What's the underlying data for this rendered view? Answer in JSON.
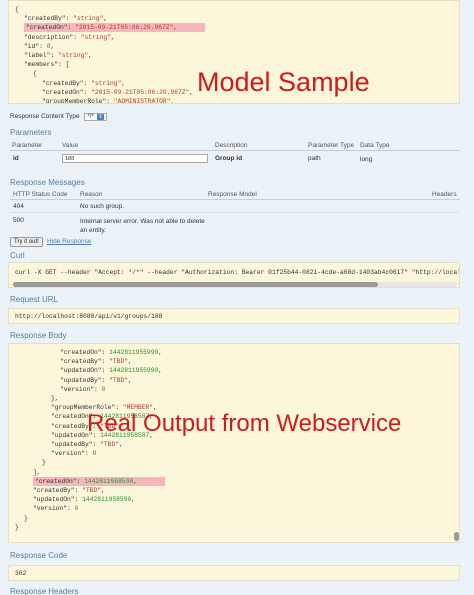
{
  "model_sample": {
    "lines": [
      {
        "indent": 0,
        "parts": [
          {
            "t": "{",
            "c": "k"
          }
        ]
      },
      {
        "indent": 1,
        "parts": [
          {
            "t": "\"createdBy\": ",
            "c": "k"
          },
          {
            "t": "\"string\"",
            "c": "s"
          },
          {
            "t": ",",
            "c": "k"
          }
        ]
      },
      {
        "indent": 1,
        "hl": true,
        "parts": [
          {
            "t": "\"createdOn\": ",
            "c": "k"
          },
          {
            "t": "\"2015-09-21T05:06:20.967Z\"",
            "c": "s"
          },
          {
            "t": ",",
            "c": "k"
          }
        ]
      },
      {
        "indent": 1,
        "parts": [
          {
            "t": "\"description\": ",
            "c": "k"
          },
          {
            "t": "\"string\"",
            "c": "s"
          },
          {
            "t": ",",
            "c": "k"
          }
        ]
      },
      {
        "indent": 1,
        "parts": [
          {
            "t": "\"id\": ",
            "c": "k"
          },
          {
            "t": "0",
            "c": "n"
          },
          {
            "t": ",",
            "c": "k"
          }
        ]
      },
      {
        "indent": 1,
        "parts": [
          {
            "t": "\"label\": ",
            "c": "k"
          },
          {
            "t": "\"string\"",
            "c": "s"
          },
          {
            "t": ",",
            "c": "k"
          }
        ]
      },
      {
        "indent": 1,
        "parts": [
          {
            "t": "\"members\": [",
            "c": "k"
          }
        ]
      },
      {
        "indent": 2,
        "parts": [
          {
            "t": "{",
            "c": "k"
          }
        ]
      },
      {
        "indent": 3,
        "parts": [
          {
            "t": "\"createdBy\": ",
            "c": "k"
          },
          {
            "t": "\"string\"",
            "c": "s"
          },
          {
            "t": ",",
            "c": "k"
          }
        ]
      },
      {
        "indent": 3,
        "parts": [
          {
            "t": "\"createdOn\": ",
            "c": "k"
          },
          {
            "t": "\"2015-09-21T05:06:20.967Z\"",
            "c": "s"
          },
          {
            "t": ",",
            "c": "k"
          }
        ]
      },
      {
        "indent": 3,
        "parts": [
          {
            "t": "\"groupMemberRole\": ",
            "c": "k"
          },
          {
            "t": "\"ADMINISTRATOR\"",
            "c": "s"
          },
          {
            "t": ",",
            "c": "k"
          }
        ]
      }
    ],
    "overlay": "Model Sample"
  },
  "response_content_type": {
    "label": "Response Content Type",
    "value": "*/*"
  },
  "parameters": {
    "title": "Parameters",
    "headers": [
      "Parameter",
      "Value",
      "Description",
      "Parameter Type",
      "Data Type"
    ],
    "rows": [
      {
        "name": "id",
        "value": "188",
        "description": "Group id",
        "type": "path",
        "data_type": "long"
      }
    ]
  },
  "response_messages": {
    "title": "Response Messages",
    "headers": [
      "HTTP Status Code",
      "Reason",
      "Response Model",
      "Headers"
    ],
    "rows": [
      {
        "code": "404",
        "reason": "No such group."
      },
      {
        "code": "500",
        "reason": "Internal server error. Was not able to delete an entity."
      }
    ]
  },
  "actions": {
    "try": "Try it out!",
    "hide": "Hide Response"
  },
  "curl": {
    "title": "Curl",
    "command": "curl -X GET --header \"Accept: */*\" --header \"Authorization: Bearer 01f25b44-0821-4cde-a68d-1403ab4c0617\" \"http://localh"
  },
  "request_url": {
    "title": "Request URL",
    "value": "http://localhost:8080/api/v1/groups/188"
  },
  "response_body": {
    "title": "Response Body",
    "overlay": "Real Output from Webservice",
    "lines": [
      {
        "indent": 5,
        "parts": [
          {
            "t": "\"createdOn\": ",
            "c": "k"
          },
          {
            "t": "1442811955990",
            "c": "n"
          },
          {
            "t": ",",
            "c": "k"
          }
        ]
      },
      {
        "indent": 5,
        "parts": [
          {
            "t": "\"createdBy\": ",
            "c": "k"
          },
          {
            "t": "\"TBD\"",
            "c": "s"
          },
          {
            "t": ",",
            "c": "k"
          }
        ]
      },
      {
        "indent": 5,
        "parts": [
          {
            "t": "\"updatedOn\": ",
            "c": "k"
          },
          {
            "t": "1442811955990",
            "c": "n"
          },
          {
            "t": ",",
            "c": "k"
          }
        ]
      },
      {
        "indent": 5,
        "parts": [
          {
            "t": "\"updatedBy\": ",
            "c": "k"
          },
          {
            "t": "\"TBD\"",
            "c": "s"
          },
          {
            "t": ",",
            "c": "k"
          }
        ]
      },
      {
        "indent": 5,
        "parts": [
          {
            "t": "\"version\": ",
            "c": "k"
          },
          {
            "t": "0",
            "c": "n"
          }
        ]
      },
      {
        "indent": 4,
        "parts": [
          {
            "t": "},",
            "c": "k"
          }
        ]
      },
      {
        "indent": 4,
        "parts": [
          {
            "t": "\"groupMemberRole\": ",
            "c": "k"
          },
          {
            "t": "\"MEMBER\"",
            "c": "s"
          },
          {
            "t": ",",
            "c": "k"
          }
        ]
      },
      {
        "indent": 4,
        "parts": [
          {
            "t": "\"createdOn\": ",
            "c": "k"
          },
          {
            "t": "1442811958587",
            "c": "n"
          },
          {
            "t": ",",
            "c": "k"
          }
        ]
      },
      {
        "indent": 4,
        "parts": [
          {
            "t": "\"createdBy\": ",
            "c": "k"
          },
          {
            "t": "\"TBD\"",
            "c": "s"
          },
          {
            "t": ",",
            "c": "k"
          }
        ]
      },
      {
        "indent": 4,
        "parts": [
          {
            "t": "\"updatedOn\": ",
            "c": "k"
          },
          {
            "t": "1442811958587",
            "c": "n"
          },
          {
            "t": ",",
            "c": "k"
          }
        ]
      },
      {
        "indent": 4,
        "parts": [
          {
            "t": "\"updatedBy\": ",
            "c": "k"
          },
          {
            "t": "\"TBD\"",
            "c": "s"
          },
          {
            "t": ",",
            "c": "k"
          }
        ]
      },
      {
        "indent": 4,
        "parts": [
          {
            "t": "\"version\": ",
            "c": "k"
          },
          {
            "t": "0",
            "c": "n"
          }
        ]
      },
      {
        "indent": 3,
        "parts": [
          {
            "t": "}",
            "c": "k"
          }
        ]
      },
      {
        "indent": 2,
        "parts": [
          {
            "t": "],",
            "c": "k"
          }
        ]
      },
      {
        "indent": 2,
        "hl": true,
        "parts": [
          {
            "t": "\"createdOn\": ",
            "c": "k"
          },
          {
            "t": "1442811958590",
            "c": "n"
          },
          {
            "t": ",",
            "c": "k"
          }
        ]
      },
      {
        "indent": 2,
        "parts": [
          {
            "t": "\"createdBy\": ",
            "c": "k"
          },
          {
            "t": "\"TBD\"",
            "c": "s"
          },
          {
            "t": ",",
            "c": "k"
          }
        ]
      },
      {
        "indent": 2,
        "parts": [
          {
            "t": "\"updatedOn\": ",
            "c": "k"
          },
          {
            "t": "1442811958590",
            "c": "n"
          },
          {
            "t": ",",
            "c": "k"
          }
        ]
      },
      {
        "indent": 2,
        "parts": [
          {
            "t": "\"version\": ",
            "c": "k"
          },
          {
            "t": "0",
            "c": "n"
          }
        ]
      },
      {
        "indent": 1,
        "parts": [
          {
            "t": "}",
            "c": "k"
          }
        ]
      },
      {
        "indent": 0,
        "parts": [
          {
            "t": "}",
            "c": "k"
          }
        ]
      }
    ]
  },
  "response_code": {
    "title": "Response Code",
    "value": "302"
  },
  "response_headers": {
    "title": "Response Headers"
  },
  "colors": {
    "page_bg": "#ebf3f9",
    "code_bg": "#fcf6db",
    "section_title": "#547f9e",
    "overlay_red": "#d11a1a",
    "highlight": "#f5b7bd"
  }
}
